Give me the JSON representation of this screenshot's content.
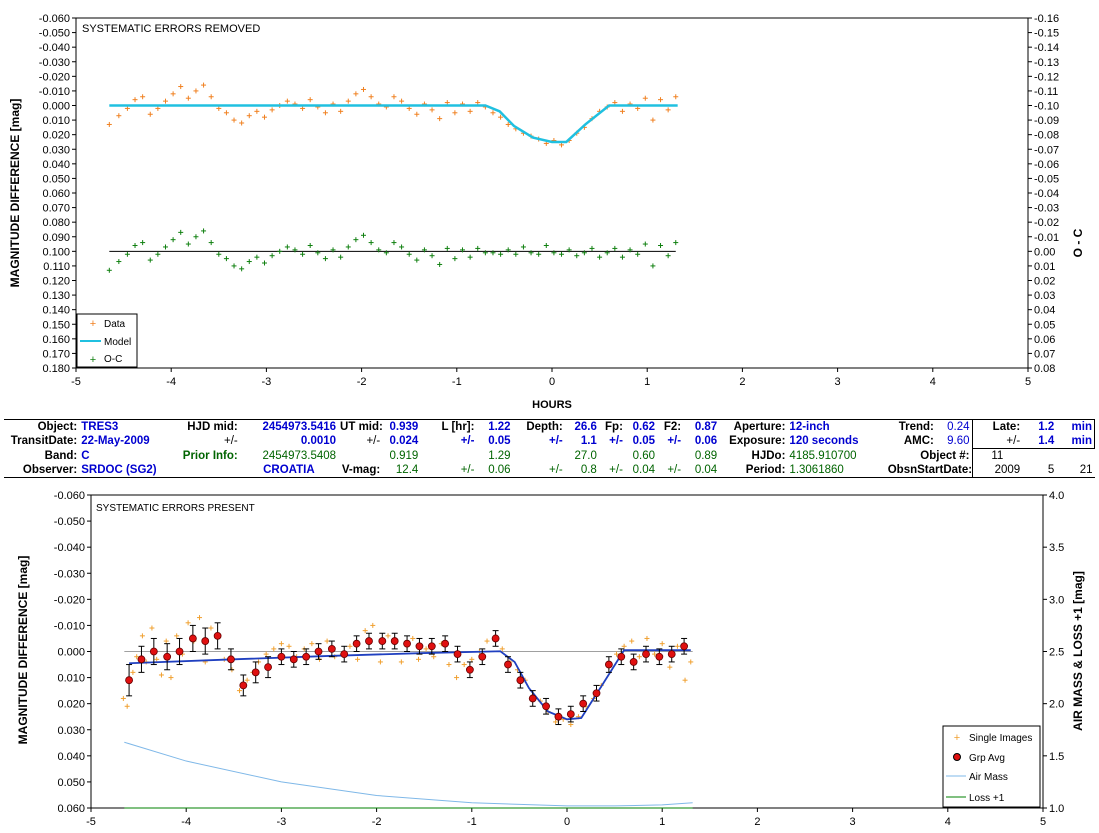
{
  "chart_data": [
    {
      "type": "scatter",
      "title": "SYSTEMATIC ERRORS REMOVED",
      "xlabel": "HOURS",
      "ylabel": "MAGNITUDE DIFFERENCE [mag]",
      "y2label": "O - C",
      "xlim": [
        -5,
        5
      ],
      "ylim": [
        0.18,
        -0.06
      ],
      "y2lim": [
        0.08,
        -0.16
      ],
      "xticks": [
        "-5",
        "-4",
        "-3",
        "-2",
        "-1",
        "0",
        "1",
        "2",
        "3",
        "4",
        "5"
      ],
      "yticks": [
        "-0.060",
        "-0.050",
        "-0.040",
        "-0.030",
        "-0.020",
        "-0.010",
        "0.000",
        "0.010",
        "0.020",
        "0.030",
        "0.040",
        "0.050",
        "0.060",
        "0.070",
        "0.080",
        "0.090",
        "0.100",
        "0.110",
        "0.120",
        "0.130",
        "0.140",
        "0.150",
        "0.160",
        "0.170",
        "0.180"
      ],
      "y2ticks": [
        "-0.16",
        "-0.15",
        "-0.14",
        "-0.13",
        "-0.12",
        "-0.11",
        "-0.10",
        "-0.09",
        "-0.08",
        "-0.07",
        "-0.06",
        "-0.05",
        "-0.04",
        "-0.03",
        "-0.02",
        "-0.01",
        "0.00",
        "0.01",
        "0.02",
        "0.03",
        "0.04",
        "0.05",
        "0.06",
        "0.07",
        "0.08"
      ],
      "legend_position": "bottom-left",
      "series": [
        {
          "name": "Data",
          "color": "#f08020",
          "marker": "plus",
          "x": [
            -4.65,
            -4.55,
            -4.46,
            -4.38,
            -4.3,
            -4.22,
            -4.14,
            -4.06,
            -3.98,
            -3.9,
            -3.82,
            -3.74,
            -3.66,
            -3.58,
            -3.5,
            -3.42,
            -3.34,
            -3.26,
            -3.18,
            -3.1,
            -3.02,
            -2.94,
            -2.86,
            -2.78,
            -2.7,
            -2.62,
            -2.54,
            -2.46,
            -2.38,
            -2.3,
            -2.22,
            -2.14,
            -2.06,
            -1.98,
            -1.9,
            -1.82,
            -1.74,
            -1.66,
            -1.58,
            -1.5,
            -1.42,
            -1.34,
            -1.26,
            -1.18,
            -1.1,
            -1.02,
            -0.94,
            -0.86,
            -0.78,
            -0.7,
            -0.62,
            -0.54,
            -0.46,
            -0.38,
            -0.3,
            -0.22,
            -0.14,
            -0.06,
            0.02,
            0.1,
            0.18,
            0.26,
            0.34,
            0.42,
            0.5,
            0.58,
            0.66,
            0.74,
            0.82,
            0.9,
            0.98,
            1.06,
            1.14,
            1.22,
            1.3
          ],
          "y": [
            0.013,
            0.007,
            0.002,
            -0.004,
            -0.006,
            0.006,
            0.002,
            -0.003,
            -0.008,
            -0.013,
            -0.005,
            -0.01,
            -0.014,
            -0.006,
            0.002,
            0.005,
            0.01,
            0.012,
            0.007,
            0.004,
            0.008,
            0.003,
            0.0,
            -0.003,
            -0.001,
            0.002,
            -0.004,
            0.001,
            0.005,
            -0.001,
            0.004,
            -0.003,
            -0.008,
            -0.011,
            -0.006,
            -0.001,
            0.001,
            -0.006,
            -0.003,
            0.002,
            0.006,
            -0.001,
            0.003,
            0.009,
            -0.002,
            0.005,
            -0.001,
            0.004,
            -0.002,
            0.001,
            0.005,
            0.008,
            0.013,
            0.016,
            0.019,
            0.021,
            0.023,
            0.026,
            0.024,
            0.027,
            0.024,
            0.019,
            0.015,
            0.009,
            0.004,
            0.001,
            -0.002,
            0.004,
            -0.001,
            0.002,
            -0.005,
            0.01,
            -0.004,
            0.003,
            -0.006
          ]
        },
        {
          "name": "Model",
          "color": "#20c0e0",
          "marker": "line",
          "x": [
            -4.65,
            -0.7,
            -0.55,
            -0.4,
            -0.2,
            0.0,
            0.15,
            0.35,
            0.6,
            1.32
          ],
          "y": [
            0.0,
            0.0,
            0.004,
            0.014,
            0.022,
            0.025,
            0.025,
            0.013,
            0.0,
            0.0
          ]
        },
        {
          "name": "O-C",
          "color": "#108010",
          "marker": "plus",
          "x": [
            -4.65,
            -4.55,
            -4.46,
            -4.38,
            -4.3,
            -4.22,
            -4.14,
            -4.06,
            -3.98,
            -3.9,
            -3.82,
            -3.74,
            -3.66,
            -3.58,
            -3.5,
            -3.42,
            -3.34,
            -3.26,
            -3.18,
            -3.1,
            -3.02,
            -2.94,
            -2.86,
            -2.78,
            -2.7,
            -2.62,
            -2.54,
            -2.46,
            -2.38,
            -2.3,
            -2.22,
            -2.14,
            -2.06,
            -1.98,
            -1.9,
            -1.82,
            -1.74,
            -1.66,
            -1.58,
            -1.5,
            -1.42,
            -1.34,
            -1.26,
            -1.18,
            -1.1,
            -1.02,
            -0.94,
            -0.86,
            -0.78,
            -0.7,
            -0.62,
            -0.54,
            -0.46,
            -0.38,
            -0.3,
            -0.22,
            -0.14,
            -0.06,
            0.02,
            0.1,
            0.18,
            0.26,
            0.34,
            0.42,
            0.5,
            0.58,
            0.66,
            0.74,
            0.82,
            0.9,
            0.98,
            1.06,
            1.14,
            1.22,
            1.3
          ],
          "y": [
            0.013,
            0.007,
            0.002,
            -0.004,
            -0.006,
            0.006,
            0.002,
            -0.003,
            -0.008,
            -0.013,
            -0.005,
            -0.01,
            -0.014,
            -0.006,
            0.002,
            0.005,
            0.01,
            0.012,
            0.007,
            0.004,
            0.008,
            0.003,
            0.0,
            -0.003,
            -0.001,
            0.002,
            -0.004,
            0.001,
            0.005,
            -0.001,
            0.004,
            -0.003,
            -0.008,
            -0.011,
            -0.006,
            -0.001,
            0.001,
            -0.006,
            -0.003,
            0.002,
            0.006,
            -0.001,
            0.003,
            0.009,
            -0.002,
            0.005,
            -0.001,
            0.004,
            -0.002,
            0.001,
            0.001,
            0.002,
            -0.001,
            0.002,
            -0.003,
            0.001,
            0.002,
            -0.004,
            0.001,
            0.002,
            -0.001,
            0.003,
            0.001,
            -0.002,
            0.004,
            0.001,
            -0.002,
            0.004,
            -0.001,
            0.002,
            -0.005,
            0.01,
            -0.004,
            0.003,
            -0.006
          ]
        }
      ]
    },
    {
      "type": "scatter",
      "title": "SYSTEMATIC ERRORS PRESENT",
      "xlabel": "",
      "ylabel": "MAGNITUDE DIFFERENCE [mag]",
      "y2label": "AIR MASS & LOSS +1 [mag]",
      "xlim": [
        -5,
        5
      ],
      "ylim": [
        0.06,
        -0.06
      ],
      "y2lim": [
        1.0,
        4.0
      ],
      "xticks": [
        "-5",
        "-4",
        "-3",
        "-2",
        "-1",
        "0",
        "1",
        "2",
        "3",
        "4",
        "5"
      ],
      "yticks": [
        "-0.060",
        "-0.050",
        "-0.040",
        "-0.030",
        "-0.020",
        "-0.010",
        "0.000",
        "0.010",
        "0.020",
        "0.030",
        "0.040",
        "0.050",
        "0.060"
      ],
      "y2ticks": [
        "4.0",
        "3.5",
        "3.0",
        "2.5",
        "2.0",
        "1.5",
        "1.0"
      ],
      "legend_position": "bottom-right",
      "series": [
        {
          "name": "Single Images",
          "color": "#f0a030",
          "marker": "plus",
          "x": [
            -4.66,
            -4.62,
            -4.56,
            -4.52,
            -4.46,
            -4.42,
            -4.36,
            -4.31,
            -4.26,
            -4.21,
            -4.16,
            -4.1,
            -4.04,
            -3.98,
            -3.92,
            -3.86,
            -3.8,
            -3.74,
            -3.68,
            -3.6,
            -3.52,
            -3.44,
            -3.36,
            -3.3,
            -3.24,
            -3.16,
            -3.08,
            -3.0,
            -2.92,
            -2.84,
            -2.76,
            -2.68,
            -2.6,
            -2.52,
            -2.44,
            -2.36,
            -2.28,
            -2.2,
            -2.12,
            -2.04,
            -1.96,
            -1.88,
            -1.8,
            -1.74,
            -1.68,
            -1.62,
            -1.56,
            -1.48,
            -1.4,
            -1.32,
            -1.24,
            -1.16,
            -1.08,
            -1.0,
            -0.92,
            -0.84,
            -0.76,
            -0.68,
            -0.6,
            -0.52,
            -0.44,
            -0.36,
            -0.28,
            -0.2,
            -0.12,
            -0.04,
            0.04,
            0.12,
            0.2,
            0.28,
            0.36,
            0.44,
            0.52,
            0.6,
            0.68,
            0.76,
            0.84,
            0.92,
            1.0,
            1.08,
            1.16,
            1.24,
            1.3
          ],
          "y": [
            0.018,
            0.021,
            0.008,
            0.002,
            -0.006,
            0.004,
            -0.009,
            0.003,
            0.009,
            -0.004,
            0.01,
            -0.006,
            0.001,
            -0.011,
            -0.004,
            -0.013,
            0.004,
            -0.009,
            -0.006,
            0.003,
            0.007,
            0.015,
            0.011,
            0.008,
            0.004,
            0.001,
            -0.001,
            -0.003,
            -0.002,
            0.002,
            -0.001,
            -0.003,
            0.003,
            -0.004,
            0.002,
            0.001,
            -0.002,
            0.003,
            -0.008,
            -0.01,
            0.004,
            -0.006,
            -0.004,
            0.004,
            -0.002,
            -0.005,
            0.003,
            -0.001,
            0.002,
            -0.003,
            0.005,
            0.01,
            0.005,
            0.003,
            0.0,
            -0.004,
            -0.005,
            -0.001,
            0.004,
            0.007,
            0.011,
            0.017,
            0.019,
            0.023,
            0.027,
            0.026,
            0.028,
            0.025,
            0.021,
            0.018,
            0.013,
            0.006,
            0.001,
            -0.002,
            -0.004,
            0.002,
            -0.005,
            0.001,
            -0.003,
            0.006,
            -0.002,
            0.011,
            0.004
          ]
        },
        {
          "name": "Grp Avg",
          "color": "#e01010",
          "marker": "circle",
          "x": [
            -4.6,
            -4.47,
            -4.34,
            -4.2,
            -4.07,
            -3.93,
            -3.8,
            -3.67,
            -3.53,
            -3.4,
            -3.27,
            -3.14,
            -3.0,
            -2.87,
            -2.74,
            -2.61,
            -2.47,
            -2.34,
            -2.21,
            -2.08,
            -1.94,
            -1.81,
            -1.68,
            -1.55,
            -1.42,
            -1.28,
            -1.15,
            -1.02,
            -0.89,
            -0.75,
            -0.62,
            -0.49,
            -0.36,
            -0.22,
            -0.09,
            0.04,
            0.17,
            0.31,
            0.44,
            0.57,
            0.7,
            0.83,
            0.97,
            1.1,
            1.23
          ],
          "y": [
            0.011,
            0.003,
            0.0,
            0.002,
            0.0,
            -0.005,
            -0.004,
            -0.006,
            0.003,
            0.013,
            0.008,
            0.006,
            0.002,
            0.003,
            0.002,
            0.0,
            -0.001,
            0.001,
            -0.003,
            -0.004,
            -0.004,
            -0.004,
            -0.003,
            -0.002,
            -0.002,
            -0.003,
            0.001,
            0.007,
            0.002,
            -0.005,
            0.005,
            0.011,
            0.018,
            0.021,
            0.025,
            0.024,
            0.02,
            0.016,
            0.005,
            0.002,
            0.004,
            0.001,
            0.002,
            0.001,
            -0.002
          ],
          "err": [
            0.006,
            0.005,
            0.005,
            0.005,
            0.005,
            0.005,
            0.005,
            0.005,
            0.004,
            0.004,
            0.004,
            0.004,
            0.003,
            0.003,
            0.003,
            0.003,
            0.003,
            0.003,
            0.003,
            0.003,
            0.003,
            0.003,
            0.003,
            0.003,
            0.003,
            0.003,
            0.003,
            0.003,
            0.003,
            0.003,
            0.003,
            0.003,
            0.003,
            0.003,
            0.003,
            0.003,
            0.003,
            0.003,
            0.003,
            0.003,
            0.003,
            0.003,
            0.003,
            0.003,
            0.003
          ]
        },
        {
          "name": "Model",
          "color": "#2040c0",
          "marker": "line",
          "x": [
            -4.6,
            -3.5,
            -2.5,
            -1.5,
            -0.7,
            -0.55,
            -0.4,
            -0.2,
            0.0,
            0.15,
            0.35,
            0.6,
            1.3
          ],
          "y": [
            0.0045,
            0.003,
            0.0017,
            0.0006,
            -0.0001,
            0.004,
            0.014,
            0.023,
            0.026,
            0.0255,
            0.014,
            -0.0005,
            -0.0005
          ]
        },
        {
          "name": "Air Mass",
          "color": "#7fb8e8",
          "marker": "line",
          "x": [
            -4.65,
            -4.0,
            -3.0,
            -2.0,
            -1.0,
            0.0,
            0.5,
            1.0,
            1.32
          ],
          "y2": [
            1.63,
            1.45,
            1.25,
            1.12,
            1.05,
            1.02,
            1.02,
            1.03,
            1.05
          ]
        },
        {
          "name": "Loss +1",
          "color": "#008000",
          "marker": "line",
          "x": [
            -4.65,
            1.32
          ],
          "y2": [
            1.0,
            1.0
          ]
        }
      ]
    }
  ],
  "info": {
    "r1": [
      "Object:",
      "TRES3",
      "HJD mid:",
      "2454973.5416",
      "UT mid:",
      "0.939",
      "L [hr]:",
      "1.22",
      "Depth:",
      "26.6",
      "Fp:",
      "0.62",
      "F2:",
      "0.87",
      "Aperture:",
      "12-inch",
      "Trend:",
      "0.24",
      "Late:",
      "1.2",
      "min"
    ],
    "r2": [
      "TransitDate:",
      "22-May-2009",
      "+/-",
      "0.0010",
      "+/-",
      "0.024",
      "+/-",
      "0.05",
      "+/-",
      "1.1",
      "+/-",
      "0.05",
      "+/-",
      "0.06",
      "Exposure:",
      "120 seconds",
      "AMC:",
      "9.60",
      "+/-",
      "1.4",
      "min"
    ],
    "r3": [
      "Band:",
      "C",
      "Prior Info:",
      "2454973.5408",
      "0.919",
      "1.29",
      "27.0",
      "0.60",
      "0.89",
      "HJDo:",
      "4185.910700",
      "Object #:",
      "11"
    ],
    "r4": [
      "Observer:",
      "SRDOC (SG2)",
      "CROATIA",
      "V-mag:",
      "12.4",
      "+/-",
      "0.06",
      "+/-",
      "0.8",
      "+/-",
      "0.04",
      "+/-",
      "0.04",
      "Period:",
      "1.3061860",
      "ObsnStartDate:",
      "2009",
      "5",
      "21"
    ]
  }
}
